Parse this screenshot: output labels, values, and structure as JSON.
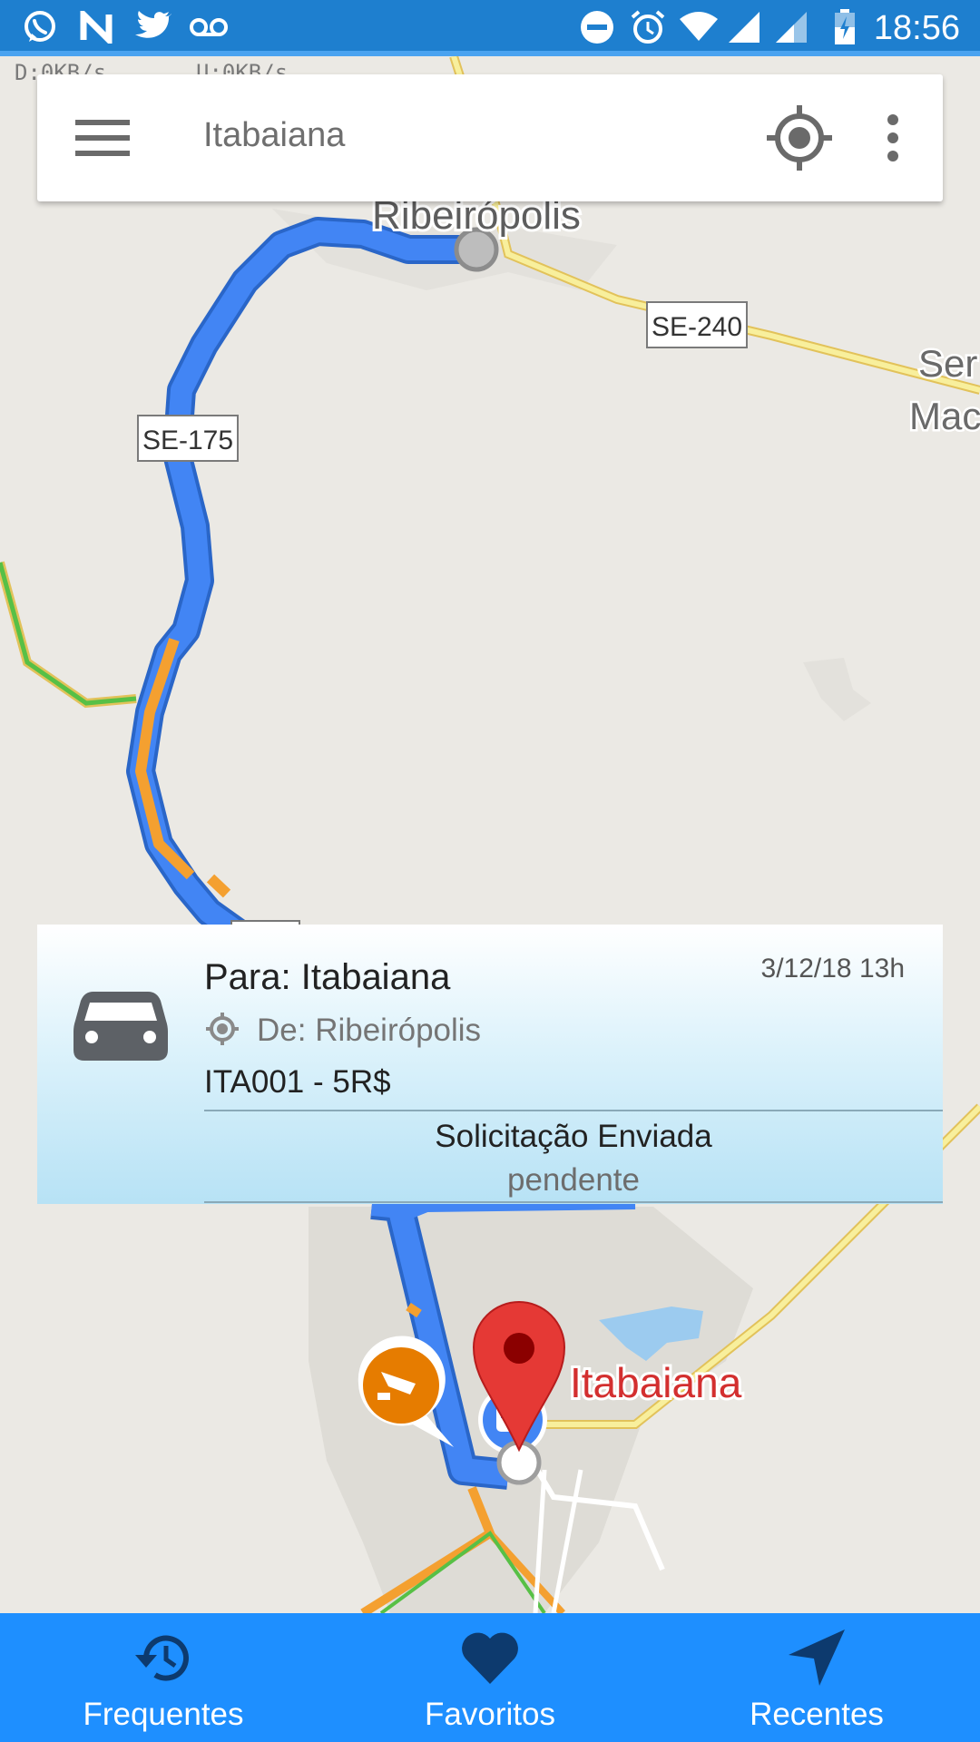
{
  "status_bar": {
    "time": "18:56",
    "left_icons": [
      "whatsapp-icon",
      "n-icon",
      "twitter-icon",
      "voicemail-icon"
    ],
    "right_icons": [
      "do-not-disturb-icon",
      "alarm-icon",
      "wifi-icon",
      "signal-icon",
      "signal-icon",
      "battery-charging-icon"
    ]
  },
  "net_speed": {
    "down": "D:0KB/s",
    "up": "U:0KB/s"
  },
  "search": {
    "query": "Itabaiana"
  },
  "map": {
    "labels": {
      "town_top": "Ribeirópolis",
      "road_1": "SE-240",
      "road_2": "SE-175",
      "town_right_1": "Ser",
      "town_right_2": "Mac",
      "destination": "Itabaiana"
    },
    "colors": {
      "route": "#4285f4",
      "traffic": "#f4a030",
      "pin": "#e53935"
    }
  },
  "ride": {
    "destination": "Para: Itabaiana",
    "date": "3/12/18 13h",
    "origin": "De: Ribeirópolis",
    "code_price": "ITA001 - 5R$",
    "status": "Solicitação Enviada",
    "status_detail": "pendente"
  },
  "nav": {
    "items": [
      {
        "label": "Frequentes",
        "icon": "history-icon"
      },
      {
        "label": "Favoritos",
        "icon": "heart-icon"
      },
      {
        "label": "Recentes",
        "icon": "navigation-arrow-icon"
      }
    ],
    "background": "#1e8fff"
  }
}
